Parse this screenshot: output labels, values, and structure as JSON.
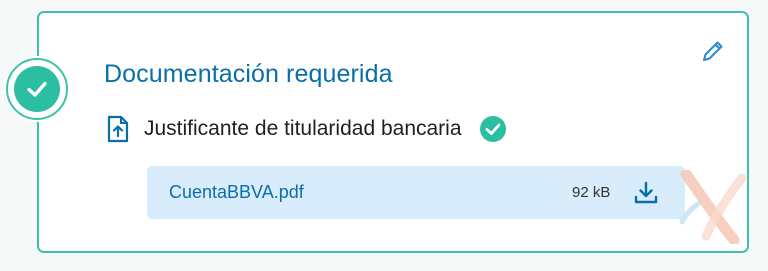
{
  "section": {
    "title": "Documentación requerida",
    "status_icon": "check-circle-icon",
    "edit_icon": "pencil-icon"
  },
  "document": {
    "label": "Justificante de titularidad bancaria",
    "type_icon": "document-upload-icon",
    "status_icon": "check-circle-icon"
  },
  "file": {
    "name": "CuentaBBVA.pdf",
    "size": "92 kB",
    "action_icon": "download-icon"
  },
  "colors": {
    "accent_teal": "#2cbea1",
    "border_teal": "#3cc2aa",
    "primary_blue": "#0b6ea8",
    "file_background": "#d8ecfb"
  }
}
